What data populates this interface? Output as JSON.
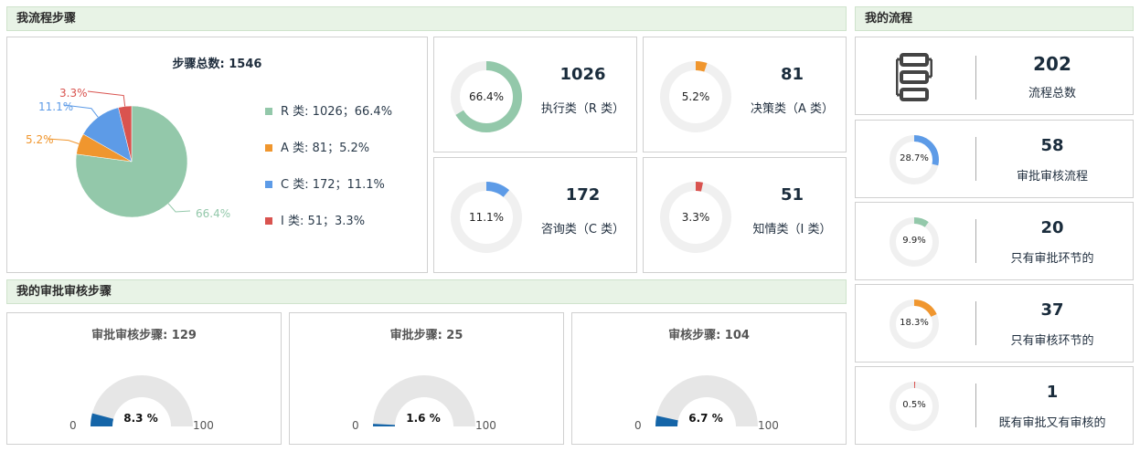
{
  "sections": {
    "my_steps": "我流程步骤",
    "my_process": "我的流程",
    "my_approval_steps": "我的审批审核步骤"
  },
  "pie": {
    "title": "步骤总数: 1546",
    "legend": [
      {
        "label": "R 类: 1026；66.4%",
        "color": "#93c8aa"
      },
      {
        "label": "A 类: 81；5.2%",
        "color": "#f0962e"
      },
      {
        "label": "C 类: 172；11.1%",
        "color": "#5d9be7"
      },
      {
        "label": "I 类: 51；3.3%",
        "color": "#d9534f"
      }
    ],
    "callouts": {
      "r": "66.4%",
      "a": "5.2%",
      "c": "11.1%",
      "i": "3.3%"
    }
  },
  "chart_data": {
    "type": "pie",
    "title": "步骤总数: 1546",
    "categories": [
      "R 类",
      "A 类",
      "C 类",
      "I 类"
    ],
    "values": [
      1026,
      81,
      172,
      51
    ],
    "percent": [
      66.4,
      5.2,
      11.1,
      3.3
    ],
    "colors": [
      "#93c8aa",
      "#f0962e",
      "#5d9be7",
      "#d9534f"
    ]
  },
  "rings": [
    {
      "pct_label": "66.4%",
      "pct": 0.664,
      "value": "1026",
      "label": "执行类（R 类）",
      "color": "#93c8aa"
    },
    {
      "pct_label": "5.2%",
      "pct": 0.052,
      "value": "81",
      "label": "决策类（A 类）",
      "color": "#f0962e"
    },
    {
      "pct_label": "11.1%",
      "pct": 0.111,
      "value": "172",
      "label": "咨询类（C 类）",
      "color": "#5d9be7"
    },
    {
      "pct_label": "3.3%",
      "pct": 0.033,
      "value": "51",
      "label": "知情类（I 类）",
      "color": "#d9534f"
    }
  ],
  "process": {
    "total": {
      "value": "202",
      "label": "流程总数",
      "icon": "flowchart-icon"
    },
    "items": [
      {
        "pct_label": "28.7%",
        "pct": 0.287,
        "value": "58",
        "label": "审批审核流程",
        "color": "#5d9be7"
      },
      {
        "pct_label": "9.9%",
        "pct": 0.099,
        "value": "20",
        "label": "只有审批环节的",
        "color": "#93c8aa"
      },
      {
        "pct_label": "18.3%",
        "pct": 0.183,
        "value": "37",
        "label": "只有审核环节的",
        "color": "#f0962e"
      },
      {
        "pct_label": "0.5%",
        "pct": 0.005,
        "value": "1",
        "label": "既有审批又有审核的",
        "color": "#d9534f"
      }
    ]
  },
  "gauges": [
    {
      "title": "审批审核步骤: 129",
      "value_label": "8.3 %",
      "pct": 0.083,
      "min": "0",
      "max": "100"
    },
    {
      "title": "审批步骤: 25",
      "value_label": "1.6 %",
      "pct": 0.016,
      "min": "0",
      "max": "100"
    },
    {
      "title": "审核步骤: 104",
      "value_label": "6.7 %",
      "pct": 0.067,
      "min": "0",
      "max": "100"
    }
  ],
  "gauge_color": "#1565a8",
  "gauge_bg": "#e6e6e6",
  "ring_bg": "#f0f0f0"
}
